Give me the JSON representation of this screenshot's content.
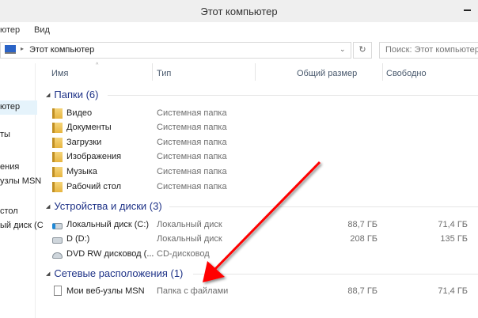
{
  "window": {
    "title": "Этот компьютер"
  },
  "menu": {
    "left_fragment": "ютер",
    "view": "Вид"
  },
  "address": {
    "path": "Этот компьютер",
    "search_placeholder": "Поиск: Этот компьютер"
  },
  "columns": [
    "Имя",
    "Тип",
    "Общий размер",
    "Свободно"
  ],
  "sidebar": [
    "ютер",
    "ты",
    "ения",
    "узлы MSN",
    "стол",
    "ый диск (C"
  ],
  "groups": [
    {
      "title": "Папки (6)",
      "items": [
        {
          "name": "Видео",
          "type": "Системная папка"
        },
        {
          "name": "Документы",
          "type": "Системная папка"
        },
        {
          "name": "Загрузки",
          "type": "Системная папка"
        },
        {
          "name": "Изображения",
          "type": "Системная папка"
        },
        {
          "name": "Музыка",
          "type": "Системная папка"
        },
        {
          "name": "Рабочий стол",
          "type": "Системная папка"
        }
      ]
    },
    {
      "title": "Устройства и диски (3)",
      "items": [
        {
          "name": "Локальный диск (C:)",
          "type": "Локальный диск",
          "total": "88,7 ГБ",
          "free": "71,4 ГБ"
        },
        {
          "name": "D (D:)",
          "type": "Локальный диск",
          "total": "208 ГБ",
          "free": "135 ГБ"
        },
        {
          "name": "DVD RW дисковод (...",
          "type": "CD-дисковод"
        }
      ]
    },
    {
      "title": "Сетевые расположения (1)",
      "items": [
        {
          "name": "Мои веб-узлы MSN",
          "type": "Папка с файлами",
          "total": "88,7 ГБ",
          "free": "71,4 ГБ"
        }
      ]
    }
  ],
  "annotation": {
    "arrow_color": "#ff0000"
  }
}
